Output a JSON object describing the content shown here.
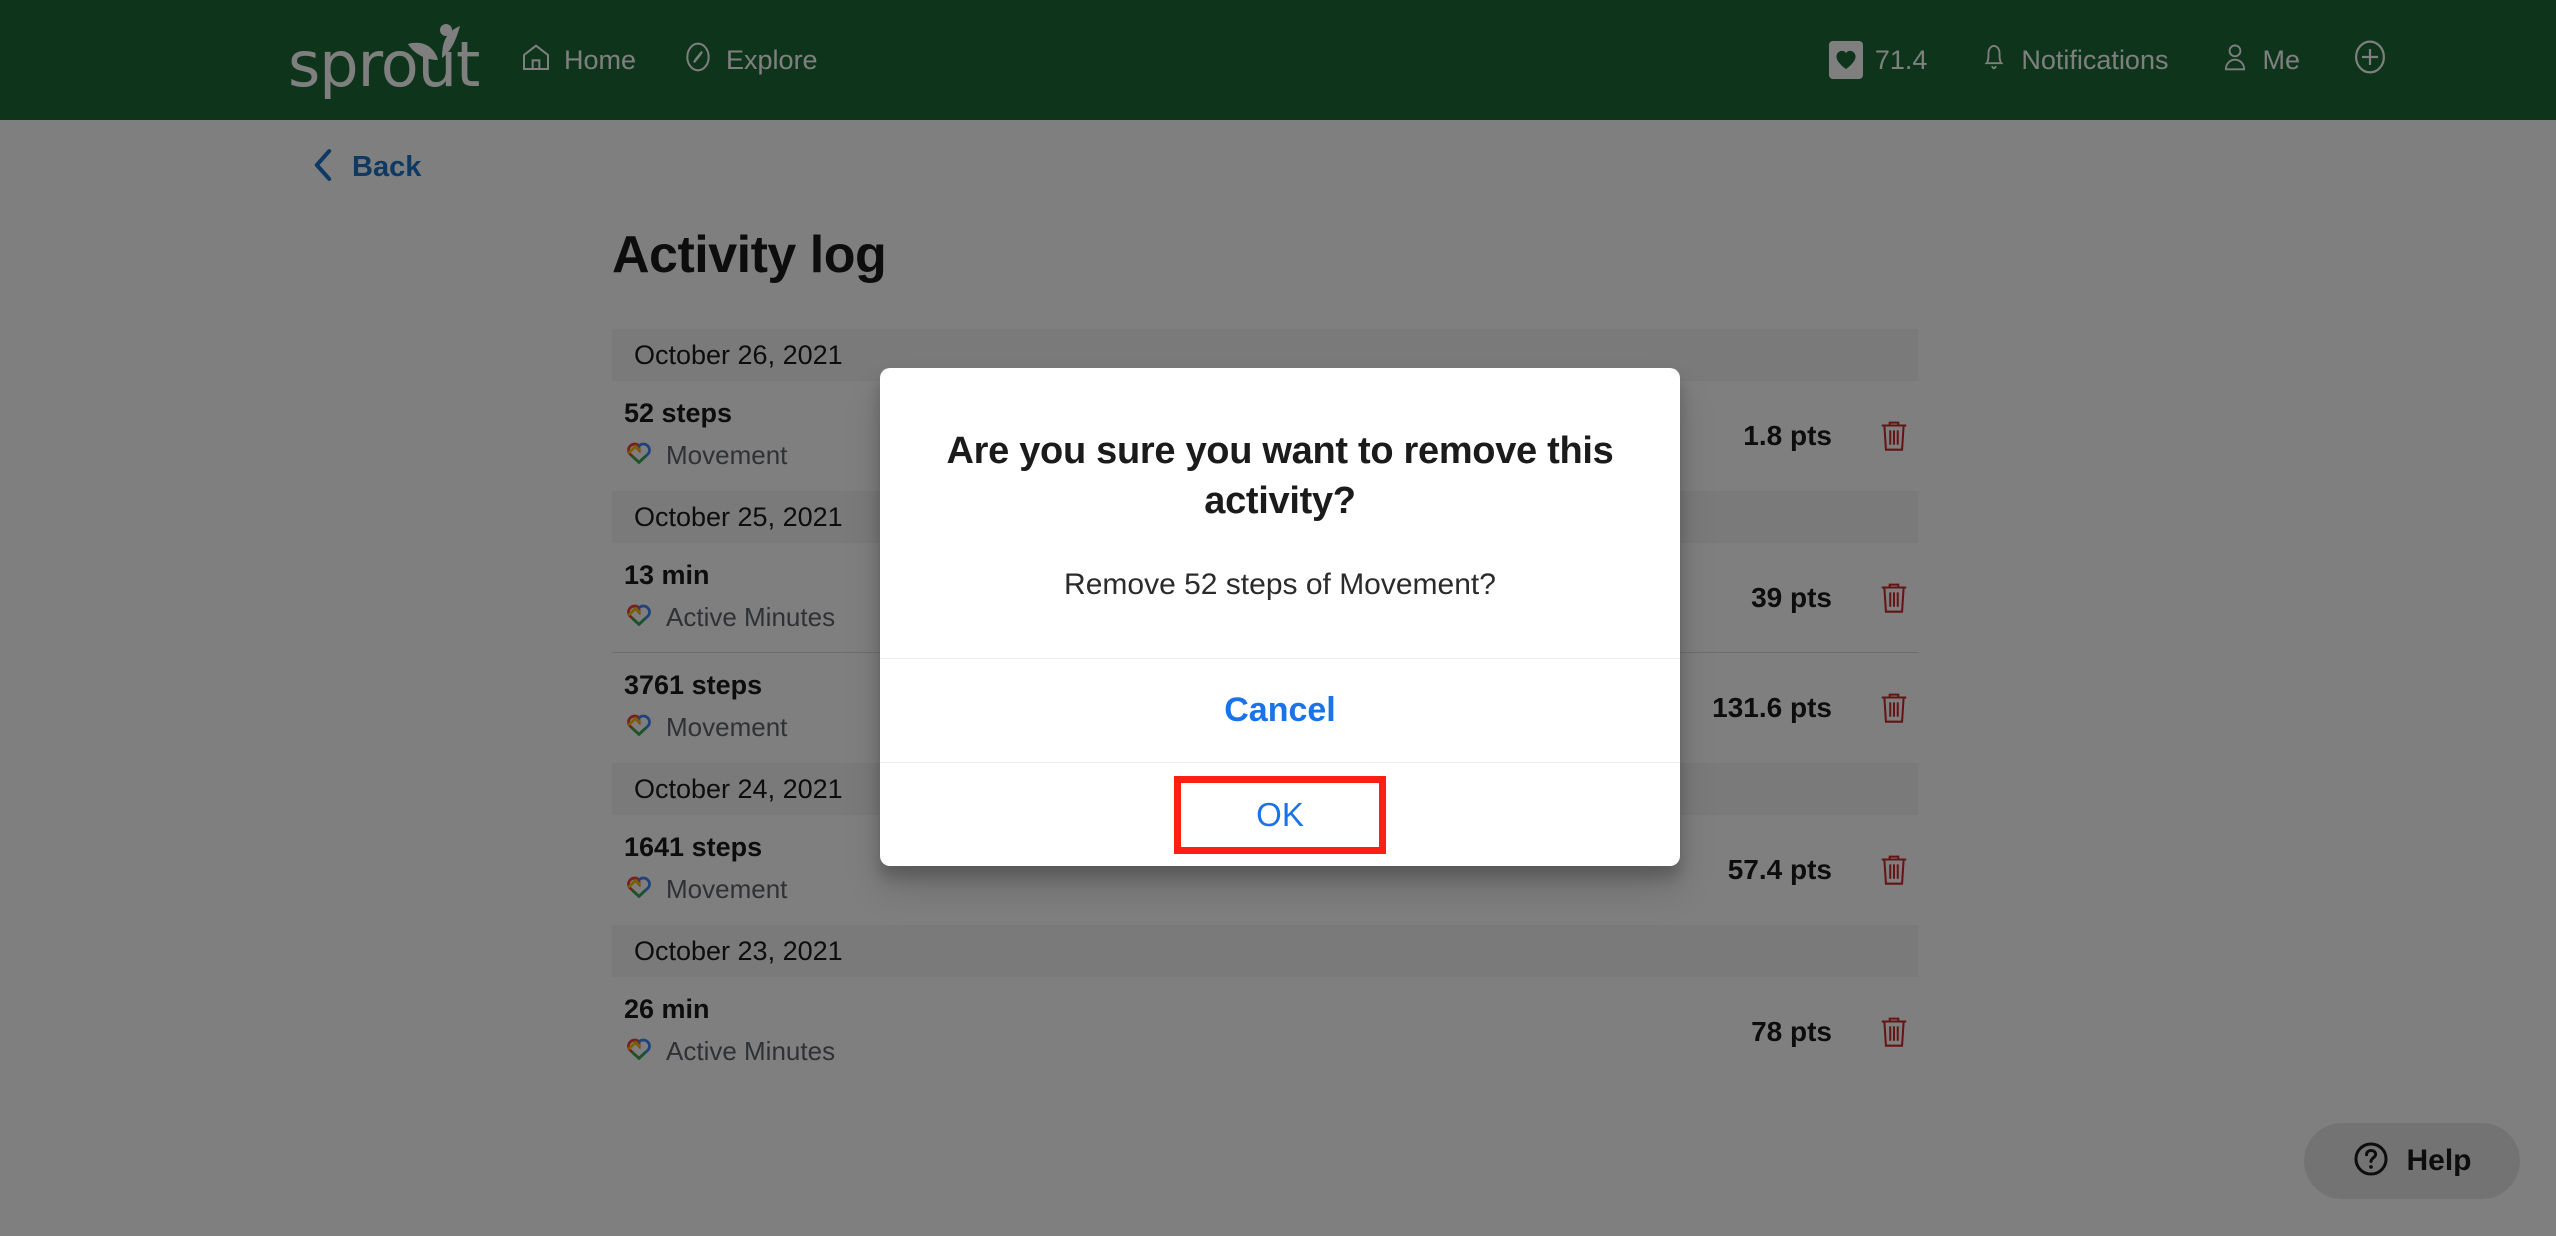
{
  "header": {
    "logo_text": "sprout",
    "logo_icon": "sprout-leaf-icon",
    "nav": [
      {
        "icon": "home-icon",
        "label": "Home"
      },
      {
        "icon": "compass-icon",
        "label": "Explore"
      }
    ],
    "points": {
      "icon": "heart-badge-icon",
      "value": "71.4"
    },
    "notifications": {
      "icon": "bell-icon",
      "label": "Notifications"
    },
    "profile": {
      "icon": "person-icon",
      "label": "Me"
    },
    "add": {
      "icon": "plus-circle-icon"
    },
    "brand_color": "#1c6b36"
  },
  "back": {
    "icon": "chevron-left-icon",
    "label": "Back",
    "color": "#1a73c4"
  },
  "main": {
    "title": "Activity log",
    "groups": [
      {
        "date": "October 26, 2021",
        "rows": [
          {
            "amount": "52 steps",
            "source": "Movement",
            "source_icon": "google-fit-icon",
            "points": "1.8 pts",
            "delete_icon": "trash-icon",
            "divider": false
          }
        ]
      },
      {
        "date": "October 25, 2021",
        "rows": [
          {
            "amount": "13 min",
            "source": "Active Minutes",
            "source_icon": "google-fit-icon",
            "points": "39 pts",
            "delete_icon": "trash-icon",
            "divider": true
          },
          {
            "amount": "3761 steps",
            "source": "Movement",
            "source_icon": "google-fit-icon",
            "points": "131.6 pts",
            "delete_icon": "trash-icon",
            "divider": false
          }
        ]
      },
      {
        "date": "October 24, 2021",
        "rows": [
          {
            "amount": "1641 steps",
            "source": "Movement",
            "source_icon": "google-fit-icon",
            "points": "57.4 pts",
            "delete_icon": "trash-icon",
            "divider": false
          }
        ]
      },
      {
        "date": "October 23, 2021",
        "rows": [
          {
            "amount": "26 min",
            "source": "Active Minutes",
            "source_icon": "google-fit-icon",
            "points": "78 pts",
            "delete_icon": "trash-icon",
            "divider": false
          }
        ]
      }
    ]
  },
  "dialog": {
    "title": "Are you sure you want to remove this activity?",
    "message": "Remove 52 steps of Movement?",
    "cancel_label": "Cancel",
    "ok_label": "OK",
    "link_color": "#1a73e8",
    "highlight_color": "#fc2013"
  },
  "help": {
    "icon": "question-circle-icon",
    "label": "Help"
  }
}
